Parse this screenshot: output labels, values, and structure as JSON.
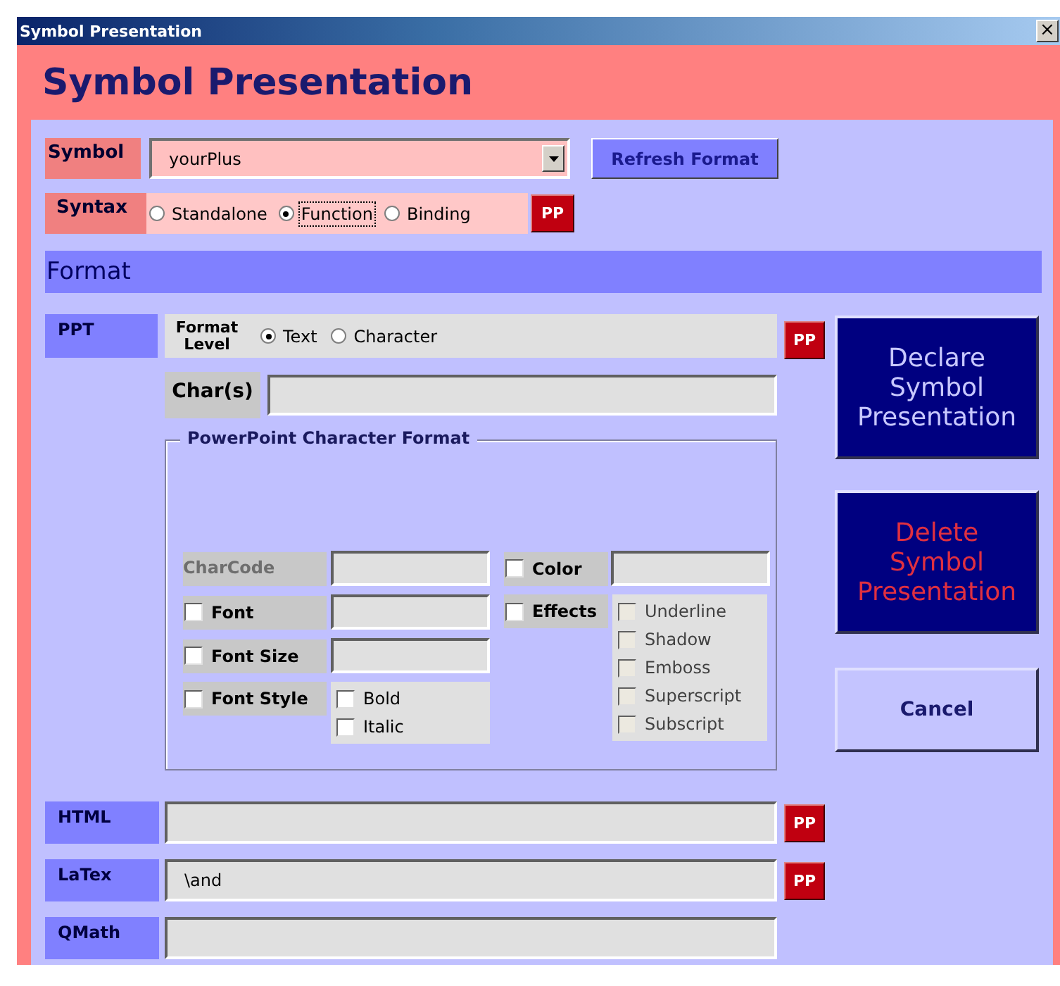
{
  "window": {
    "title": "Symbol Presentation",
    "close": "×"
  },
  "heading": "Symbol Presentation",
  "symbol": {
    "label": "Symbol",
    "value": "yourPlus",
    "refresh_button": "Refresh Format"
  },
  "syntax": {
    "label": "Syntax",
    "options": [
      {
        "label": "Standalone",
        "selected": false
      },
      {
        "label": "Function",
        "selected": true
      },
      {
        "label": "Binding",
        "selected": false
      }
    ],
    "pp_button": "PP"
  },
  "format_header": "Format",
  "ppt": {
    "label": "PPT",
    "format_level": {
      "label": "Format Level",
      "options": [
        {
          "label": "Text",
          "selected": true
        },
        {
          "label": "Character",
          "selected": false
        }
      ]
    },
    "pp_button": "PP",
    "chars": {
      "label": "Char(s)"
    }
  },
  "character_format": {
    "title": "PowerPoint Character Format",
    "charcode": {
      "label": "CharCode",
      "disabled": true
    },
    "color": {
      "label": "Color",
      "checked": false
    },
    "font": {
      "label": "Font",
      "checked": false
    },
    "effects": {
      "label": "Effects",
      "checked": false,
      "options": [
        {
          "label": "Underline",
          "checked": false,
          "disabled": true
        },
        {
          "label": "Shadow",
          "checked": false,
          "disabled": true
        },
        {
          "label": "Emboss",
          "checked": false,
          "disabled": true
        },
        {
          "label": "Superscript",
          "checked": false,
          "disabled": true
        },
        {
          "label": "Subscript",
          "checked": false,
          "disabled": true
        }
      ]
    },
    "font_size": {
      "label": "Font Size",
      "checked": false
    },
    "font_style": {
      "label": "Font Style",
      "checked": false,
      "options": [
        {
          "label": "Bold",
          "checked": false,
          "disabled": false
        },
        {
          "label": "Italic",
          "checked": false,
          "disabled": false
        }
      ]
    }
  },
  "actions": [
    {
      "label": "Declare Symbol Presentation",
      "kind": "primary"
    },
    {
      "label": "Delete Symbol Presentation",
      "kind": "danger"
    },
    {
      "label": "Cancel",
      "kind": "plain"
    }
  ],
  "outputs": [
    {
      "label": "HTML",
      "pp_button": "PP"
    },
    {
      "label": "LaTex",
      "value": "\\and",
      "pp_button": "PP"
    },
    {
      "label": "QMath"
    }
  ]
}
